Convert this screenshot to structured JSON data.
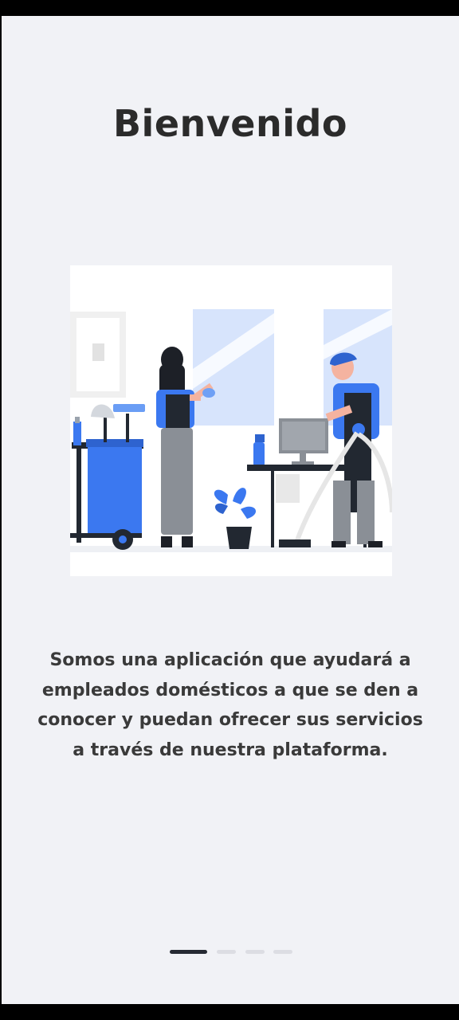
{
  "onboarding": {
    "title": "Bienvenido",
    "description": "Somos una aplicación que ayudará a empleados domésticos a que se den a conocer y puedan ofrecer sus servicios a través de nuestra plataforma.",
    "illustration_icon": "cleaning-staff-illustration",
    "pager": {
      "total_pages": 4,
      "active_index": 0
    }
  },
  "colors": {
    "background": "#f1f2f6",
    "title": "#2b2b2b",
    "text": "#3a3a3a",
    "accent": "#3b78f0",
    "pager_active": "#262a33",
    "pager_inactive": "#dcdde3"
  }
}
